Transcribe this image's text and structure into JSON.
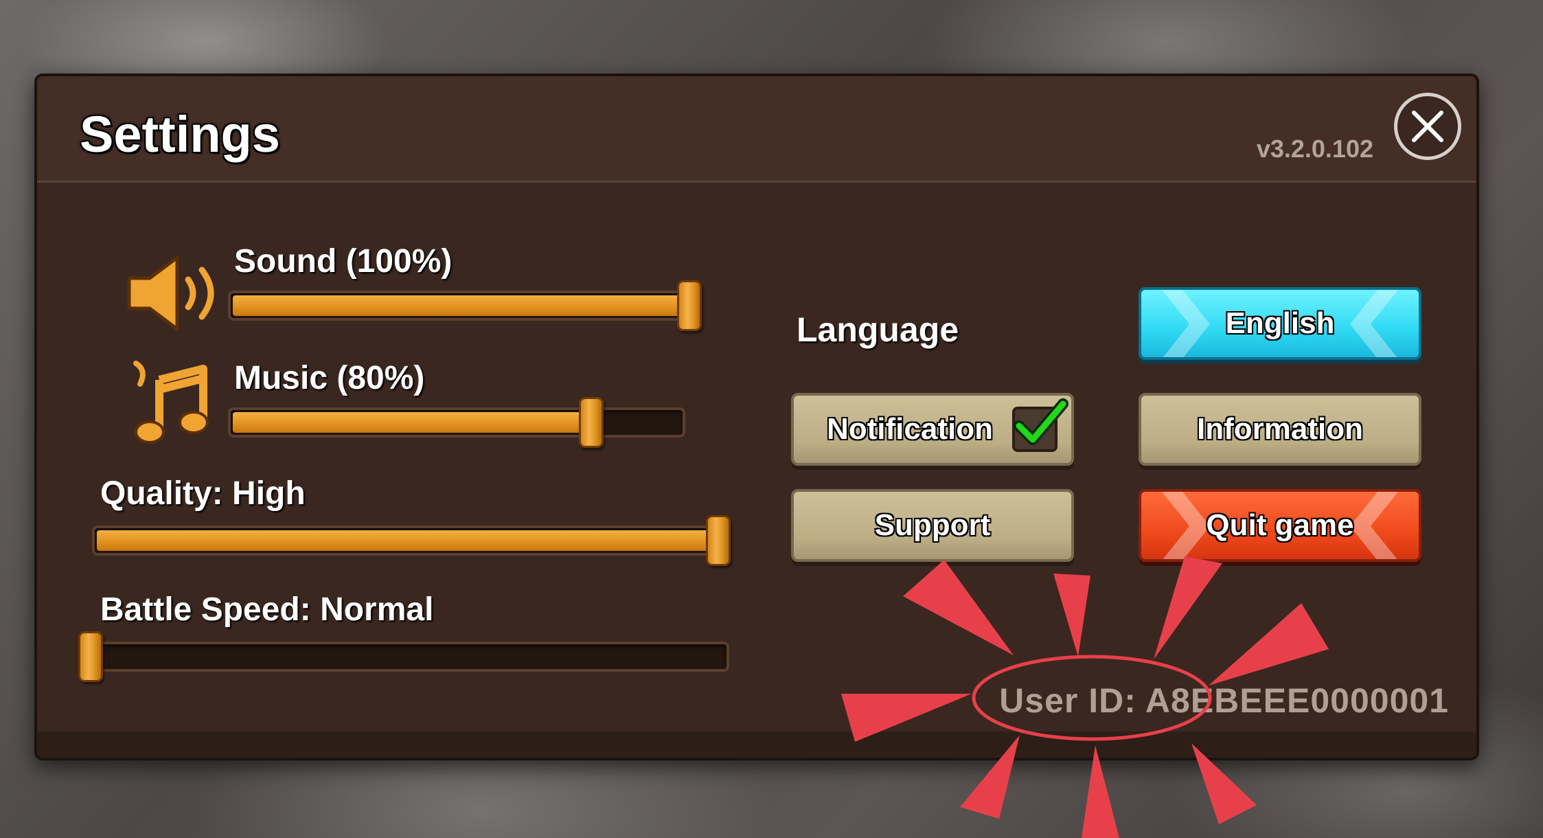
{
  "header": {
    "title": "Settings",
    "version": "v3.2.0.102"
  },
  "audio": {
    "sound": {
      "label": "Sound (100%)",
      "level": 1.0
    },
    "music": {
      "label": "Music (80%)",
      "level": 0.8
    }
  },
  "quality": {
    "label": "Quality: High",
    "level": 1.0
  },
  "battle_speed": {
    "label": "Battle Speed: Normal",
    "level": 0.0
  },
  "language": {
    "label": "Language",
    "current": "English"
  },
  "buttons": {
    "notification": {
      "label": "Notification",
      "checked": true
    },
    "information": "Information",
    "support": "Support",
    "quit": "Quit game"
  },
  "footer": {
    "user_id": "User ID: A8EBEEE0000001"
  },
  "colors": {
    "panel": "#3d2a22",
    "slider_fill": "#e0901e",
    "blue_button": "#2fd9f3",
    "red_button": "#f04a1c",
    "tan_button": "#bcad85",
    "annotation": "#e8404a"
  },
  "icons": [
    "speaker-icon",
    "music-note-icon",
    "close-icon",
    "checkmark-icon"
  ]
}
